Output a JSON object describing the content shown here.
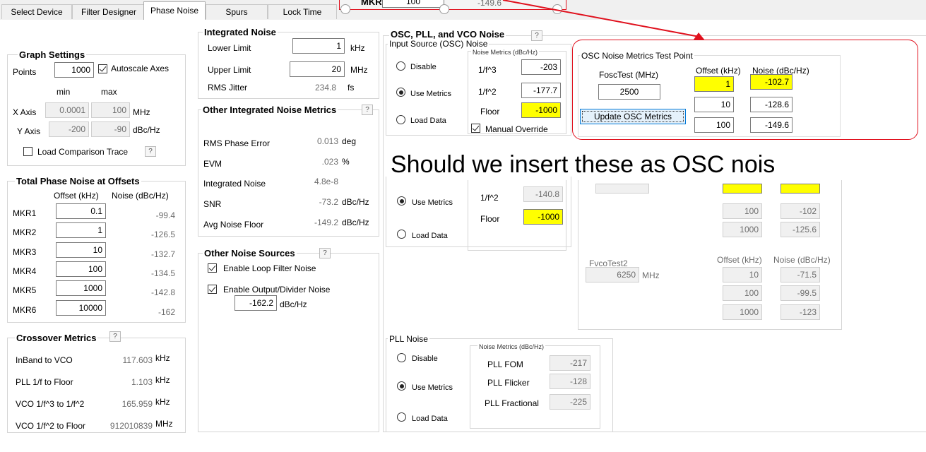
{
  "tabs": [
    "Select Device",
    "Filter Designer",
    "Phase Noise",
    "Spurs",
    "Lock Time"
  ],
  "active_tab": "Phase Noise",
  "top_callout": {
    "label": "MKR4",
    "offset": "100",
    "noise": "-149.6"
  },
  "graph_settings": {
    "title": "Graph Settings",
    "points_label": "Points",
    "points": "1000",
    "autoscale_label": "Autoscale Axes",
    "min_label": "min",
    "max_label": "max",
    "xaxis_label": "X Axis",
    "xmin": "0.0001",
    "xmax": "100",
    "xunit": "MHz",
    "yaxis_label": "Y Axis",
    "ymin": "-200",
    "ymax": "-90",
    "yunit": "dBc/Hz",
    "load_comparison_label": "Load Comparison Trace",
    "help": "?"
  },
  "total_pn": {
    "title": "Total Phase Noise at Offsets",
    "offset_header": "Offset (kHz)",
    "noise_header": "Noise (dBc/Hz)",
    "rows": [
      {
        "name": "MKR1",
        "offset": "0.1",
        "noise": "-99.4"
      },
      {
        "name": "MKR2",
        "offset": "1",
        "noise": "-126.5"
      },
      {
        "name": "MKR3",
        "offset": "10",
        "noise": "-132.7"
      },
      {
        "name": "MKR4",
        "offset": "100",
        "noise": "-134.5"
      },
      {
        "name": "MKR5",
        "offset": "1000",
        "noise": "-142.8"
      },
      {
        "name": "MKR6",
        "offset": "10000",
        "noise": "-162"
      }
    ]
  },
  "crossover": {
    "title": "Crossover Metrics",
    "rows": [
      {
        "label": "InBand to VCO",
        "value": "117.603",
        "unit": "kHz"
      },
      {
        "label": "PLL 1/f to Floor",
        "value": "1.103",
        "unit": "kHz"
      },
      {
        "label": "VCO 1/f^3 to 1/f^2",
        "value": "165.959",
        "unit": "kHz"
      },
      {
        "label": "VCO 1/f^2 to Floor",
        "value": "912010839",
        "unit": "MHz"
      }
    ]
  },
  "integrated": {
    "title": "Integrated Noise",
    "lower_label": "Lower Limit",
    "lower": "1",
    "lower_unit": "kHz",
    "upper_label": "Upper Limit",
    "upper": "20",
    "upper_unit": "MHz",
    "rms_label": "RMS Jitter",
    "rms": "234.8",
    "rms_unit": "fs"
  },
  "other_metrics": {
    "title": "Other Integrated Noise Metrics",
    "rows": [
      {
        "label": "RMS Phase Error",
        "value": "0.013",
        "unit": "deg"
      },
      {
        "label": "EVM",
        "value": ".023",
        "unit": "%"
      },
      {
        "label": "Integrated Noise",
        "value": "4.8e-8",
        "unit": ""
      },
      {
        "label": "SNR",
        "value": "-73.2",
        "unit": "dBc/Hz"
      },
      {
        "label": "Avg Noise Floor",
        "value": "-149.2",
        "unit": "dBc/Hz"
      }
    ]
  },
  "other_sources": {
    "title": "Other Noise Sources",
    "loop_filter_label": "Enable Loop Filter Noise",
    "output_label": "Enable Output/Divider Noise",
    "output_value": "-162.2",
    "output_unit": "dBc/Hz"
  },
  "osc_pll_vco": {
    "title": "OSC, PLL, and VCO Noise",
    "input_title": "Input Source (OSC) Noise",
    "disable": "Disable",
    "use_metrics": "Use Metrics",
    "load_data": "Load Data",
    "metrics_title": "Noise Metrics (dBc/Hz)",
    "f3_label": "1/f^3",
    "f3": "-203",
    "f2_label": "1/f^2",
    "f2": "-177.7",
    "floor_label": "Floor",
    "floor": "-1000",
    "manual_override": "Manual Override"
  },
  "osc_test": {
    "title": "OSC Noise Metrics Test Point",
    "fosc_label": "FoscTest (MHz)",
    "fosc": "2500",
    "offset_header": "Offset (kHz)",
    "noise_header": "Noise (dBc/Hz)",
    "rows": [
      {
        "offset": "1",
        "noise": "-102.7"
      },
      {
        "offset": "10",
        "noise": "-128.6"
      },
      {
        "offset": "100",
        "noise": "-149.6"
      }
    ],
    "update_button": "Update OSC Metrics"
  },
  "annotation": "Should we insert these as OSC nois",
  "vco": {
    "f2_label": "1/f^2",
    "f2": "-140.8",
    "floor_label": "Floor",
    "floor": "-1000",
    "use_metrics": "Use Metrics",
    "load_data": "Load Data",
    "t1_rows": [
      {
        "offset": "100",
        "noise": "-102"
      },
      {
        "offset": "1000",
        "noise": "-125.6"
      }
    ],
    "fvco2_label": "FvcoTest2",
    "fvco2": "6250",
    "fvco2_unit": "MHz",
    "offset_header": "Offset (kHz)",
    "noise_header": "Noise (dBc/Hz)",
    "t2_rows": [
      {
        "offset": "10",
        "noise": "-71.5"
      },
      {
        "offset": "100",
        "noise": "-99.5"
      },
      {
        "offset": "1000",
        "noise": "-123"
      }
    ]
  },
  "pll": {
    "title": "PLL Noise",
    "disable": "Disable",
    "use_metrics": "Use Metrics",
    "load_data": "Load Data",
    "metrics_title": "Noise Metrics (dBc/Hz)",
    "fom_label": "PLL FOM",
    "fom": "-217",
    "flicker_label": "PLL Flicker",
    "flicker": "-128",
    "fractional_label": "PLL Fractional",
    "fractional": "-225"
  },
  "colors": {
    "highlight": "#ffff00",
    "callout": "#e0101d"
  }
}
